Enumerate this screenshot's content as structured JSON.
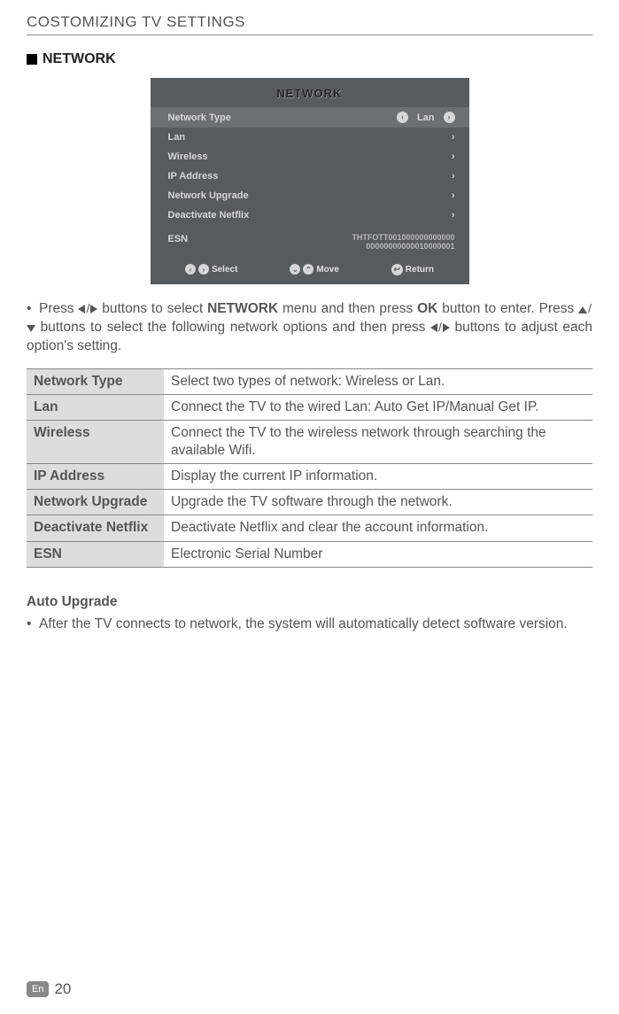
{
  "header": {
    "title": "COSTOMIZING TV SETTINGS"
  },
  "section": {
    "heading": "NETWORK"
  },
  "tv_menu": {
    "title": "NETWORK",
    "rows": {
      "network_type": {
        "label": "Network Type",
        "value": "Lan"
      },
      "lan": {
        "label": "Lan"
      },
      "wireless": {
        "label": "Wireless"
      },
      "ip_address": {
        "label": "IP Address"
      },
      "network_upgrade": {
        "label": "Network Upgrade"
      },
      "deactivate_netflix": {
        "label": "Deactivate Netflix"
      },
      "esn": {
        "label": "ESN",
        "value_line1": "THTFOTT001000000000000",
        "value_line2": "00000000000010000001"
      }
    },
    "footer": {
      "select": "Select",
      "move": "Move",
      "return": "Return"
    }
  },
  "instructions": {
    "pre1": "Press ",
    "mid1": " buttons to select ",
    "network": "NETWORK",
    "mid2": " menu and then press ",
    "ok": "OK",
    "mid3": " button to enter. Press ",
    "mid4": " buttons to select the following network options and then press ",
    "post": " buttons to adjust each option's setting."
  },
  "table": {
    "r1": {
      "label": "Network Type",
      "desc": "Select two types of network: Wireless or Lan."
    },
    "r2": {
      "label": "Lan",
      "desc": "Connect the TV to the wired Lan: Auto Get IP/Manual Get IP."
    },
    "r3": {
      "label": "Wireless",
      "desc": "Connect the TV to the wireless network through searching the available Wifi."
    },
    "r4": {
      "label": "IP Address",
      "desc": "Display the current IP information."
    },
    "r5": {
      "label": "Network Upgrade",
      "desc": "Upgrade the TV software through the network."
    },
    "r6": {
      "label": "Deactivate Netflix",
      "desc": "Deactivate Netflix and clear the account information."
    },
    "r7": {
      "label": "ESN",
      "desc": "Electronic Serial Number"
    }
  },
  "auto_upgrade": {
    "heading": "Auto Upgrade",
    "text": "After the TV connects to network, the system will automatically detect software version."
  },
  "footer": {
    "lang": "En",
    "page": "20"
  }
}
